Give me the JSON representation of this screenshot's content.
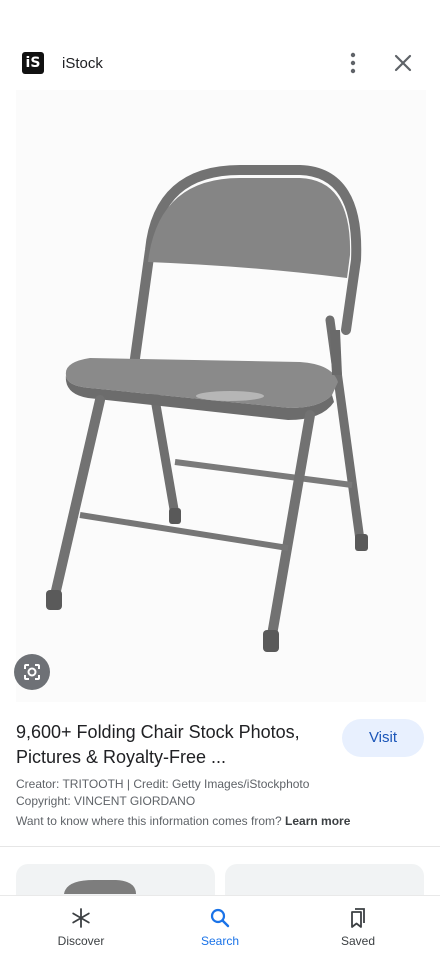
{
  "header": {
    "logo_text": "iS",
    "site_name": "iStock"
  },
  "result": {
    "title": "9,600+ Folding Chair Stock Photos, Pictures & Royalty-Free ...",
    "visit_label": "Visit",
    "creator_line": "Creator: TRITOOTH | Credit: Getty Images/iStockphoto",
    "copyright_line": "Copyright: VINCENT GIORDANO",
    "info_prefix": "Want to know where this information comes from?",
    "info_link": "Learn more"
  },
  "nav": {
    "items": [
      {
        "label": "Discover",
        "icon": "asterisk-icon"
      },
      {
        "label": "Search",
        "icon": "search-icon"
      },
      {
        "label": "Saved",
        "icon": "bookmarks-icon"
      }
    ],
    "active": "Search"
  },
  "colors": {
    "accent": "#1a73e8",
    "chair": "#7a7a7a",
    "visit_bg": "#e8f0fe"
  }
}
